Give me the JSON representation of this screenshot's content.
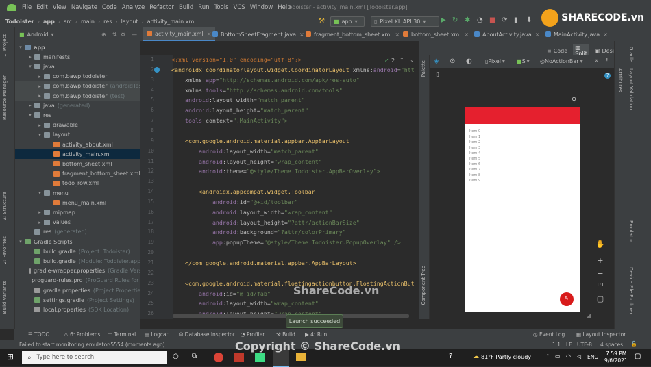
{
  "menu": {
    "items": [
      "File",
      "Edit",
      "View",
      "Navigate",
      "Code",
      "Analyze",
      "Refactor",
      "Build",
      "Run",
      "Tools",
      "VCS",
      "Window",
      "Help"
    ],
    "window_title": "Todoister - activity_main.xml [Todoister.app]"
  },
  "nav": {
    "crumbs": [
      "Todoister",
      "app",
      "src",
      "main",
      "res",
      "layout",
      "activity_main.xml"
    ],
    "run_config": "app",
    "device": "Pixel XL API 30"
  },
  "tabs": {
    "project_label": "Android",
    "files": [
      "activity_main.xml",
      "BottomSheetFragment.java",
      "fragment_bottom_sheet.xml",
      "bottom_sheet.xml",
      "AboutActivity.java",
      "MainActivity.java"
    ]
  },
  "view_modes": [
    "Code",
    "Split",
    "Design"
  ],
  "left_stripe": [
    "1: Project",
    "Resource Manager",
    "Z: Structure",
    "2: Favorites",
    "Build Variants"
  ],
  "right_stripe": [
    "Gradle",
    "Attributes",
    "Layout Validation",
    "Emulator",
    "Device File Explorer"
  ],
  "project_tree": [
    {
      "label": "app",
      "indent": 0,
      "arrow": "▾",
      "icon": "foldb",
      "bold": true
    },
    {
      "label": "manifests",
      "indent": 1,
      "arrow": "▸",
      "icon": "fold"
    },
    {
      "label": "java",
      "indent": 1,
      "arrow": "▾",
      "icon": "fold"
    },
    {
      "label": "com.bawp.todoister",
      "indent": 2,
      "arrow": "▸",
      "icon": "fold"
    },
    {
      "label": "com.bawp.todoister",
      "suffix": "(androidTest)",
      "indent": 2,
      "arrow": "▸",
      "icon": "fold",
      "hl": true
    },
    {
      "label": "com.bawp.todoister",
      "suffix": "(test)",
      "indent": 2,
      "arrow": "▸",
      "icon": "fold",
      "hl": true
    },
    {
      "label": "java",
      "suffix": "(generated)",
      "indent": 1,
      "arrow": "▸",
      "icon": "fold"
    },
    {
      "label": "res",
      "indent": 1,
      "arrow": "▾",
      "icon": "fold"
    },
    {
      "label": "drawable",
      "indent": 2,
      "arrow": "▸",
      "icon": "fold"
    },
    {
      "label": "layout",
      "indent": 2,
      "arrow": "▾",
      "icon": "fold"
    },
    {
      "label": "activity_about.xml",
      "indent": 3,
      "arrow": "",
      "icon": "xml"
    },
    {
      "label": "activity_main.xml",
      "indent": 3,
      "arrow": "",
      "icon": "xml",
      "sel": true
    },
    {
      "label": "bottom_sheet.xml",
      "indent": 3,
      "arrow": "",
      "icon": "xml"
    },
    {
      "label": "fragment_bottom_sheet.xml",
      "indent": 3,
      "arrow": "",
      "icon": "xml"
    },
    {
      "label": "todo_row.xml",
      "indent": 3,
      "arrow": "",
      "icon": "xml"
    },
    {
      "label": "menu",
      "indent": 2,
      "arrow": "▾",
      "icon": "fold"
    },
    {
      "label": "menu_main.xml",
      "indent": 3,
      "arrow": "",
      "icon": "xml"
    },
    {
      "label": "mipmap",
      "indent": 2,
      "arrow": "▸",
      "icon": "fold"
    },
    {
      "label": "values",
      "indent": 2,
      "arrow": "▸",
      "icon": "fold"
    },
    {
      "label": "res",
      "suffix": "(generated)",
      "indent": 1,
      "arrow": "",
      "icon": "fold"
    },
    {
      "label": "Gradle Scripts",
      "indent": 0,
      "arrow": "▾",
      "icon": "grad"
    },
    {
      "label": "build.gradle",
      "suffix": "(Project: Todoister)",
      "indent": 1,
      "arrow": "",
      "icon": "grad"
    },
    {
      "label": "build.gradle",
      "suffix": "(Module: Todoister.app)",
      "indent": 1,
      "arrow": "",
      "icon": "grad"
    },
    {
      "label": "gradle-wrapper.properties",
      "suffix": "(Gradle Version)",
      "indent": 1,
      "arrow": "",
      "icon": "prop"
    },
    {
      "label": "proguard-rules.pro",
      "suffix": "(ProGuard Rules for Todoister.app)",
      "indent": 1,
      "arrow": "",
      "icon": "prop"
    },
    {
      "label": "gradle.properties",
      "suffix": "(Project Properties)",
      "indent": 1,
      "arrow": "",
      "icon": "prop"
    },
    {
      "label": "settings.gradle",
      "suffix": "(Project Settings)",
      "indent": 1,
      "arrow": "",
      "icon": "grad"
    },
    {
      "label": "local.properties",
      "suffix": "(SDK Location)",
      "indent": 1,
      "arrow": "",
      "icon": "prop"
    }
  ],
  "code": {
    "line_numbers": [
      "1",
      "2",
      "3",
      "4",
      "5",
      "6",
      "7",
      "8",
      "9",
      "10",
      "11",
      "12",
      "13",
      "14",
      "15",
      "16",
      "17",
      "18",
      "19",
      "20",
      "21",
      "22",
      "23",
      "24",
      "25",
      "26"
    ],
    "lines": [
      [
        {
          "c": "decl",
          "t": "<?xml version=\"1.0\" encoding=\"utf-8\"?>"
        }
      ],
      [
        {
          "c": "tag",
          "t": "<androidx.coordinatorlayout.widget.CoordinatorLayout "
        },
        {
          "c": "attr",
          "t": "xmlns:"
        },
        {
          "c": "ns",
          "t": "android"
        },
        {
          "c": "attr",
          "t": "="
        },
        {
          "c": "val",
          "t": "\"http://schemas.android.com/apk/res/android\""
        }
      ],
      [
        {
          "c": "attr",
          "t": "    xmlns:"
        },
        {
          "c": "ns",
          "t": "app"
        },
        {
          "c": "attr",
          "t": "="
        },
        {
          "c": "val",
          "t": "\"http://schemas.android.com/apk/res-auto\""
        }
      ],
      [
        {
          "c": "attr",
          "t": "    xmlns:"
        },
        {
          "c": "ns",
          "t": "tools"
        },
        {
          "c": "attr",
          "t": "="
        },
        {
          "c": "val",
          "t": "\"http://schemas.android.com/tools\""
        }
      ],
      [
        {
          "c": "ns",
          "t": "    android"
        },
        {
          "c": "attr",
          "t": ":layout_width="
        },
        {
          "c": "val",
          "t": "\"match_parent\""
        }
      ],
      [
        {
          "c": "ns",
          "t": "    android"
        },
        {
          "c": "attr",
          "t": ":layout_height="
        },
        {
          "c": "val",
          "t": "\"match_parent\""
        }
      ],
      [
        {
          "c": "ns",
          "t": "    tools"
        },
        {
          "c": "attr",
          "t": ":context="
        },
        {
          "c": "val",
          "t": "\".MainActivity\">"
        }
      ],
      [
        {
          "c": "attr",
          "t": ""
        }
      ],
      [
        {
          "c": "tag",
          "t": "    <com.google.android.material.appbar.AppBarLayout"
        }
      ],
      [
        {
          "c": "ns",
          "t": "        android"
        },
        {
          "c": "attr",
          "t": ":layout_width="
        },
        {
          "c": "val",
          "t": "\"match_parent\""
        }
      ],
      [
        {
          "c": "ns",
          "t": "        android"
        },
        {
          "c": "attr",
          "t": ":layout_height="
        },
        {
          "c": "val",
          "t": "\"wrap_content\""
        }
      ],
      [
        {
          "c": "ns",
          "t": "        android"
        },
        {
          "c": "attr",
          "t": ":theme="
        },
        {
          "c": "val",
          "t": "\"@style/Theme.Todoister.AppBarOverlay\">"
        }
      ],
      [
        {
          "c": "attr",
          "t": ""
        }
      ],
      [
        {
          "c": "tag",
          "t": "        <androidx.appcompat.widget.Toolbar"
        }
      ],
      [
        {
          "c": "ns",
          "t": "            android"
        },
        {
          "c": "attr",
          "t": ":id="
        },
        {
          "c": "val",
          "t": "\"@+id/toolbar\""
        }
      ],
      [
        {
          "c": "ns",
          "t": "            android"
        },
        {
          "c": "attr",
          "t": ":layout_width="
        },
        {
          "c": "val",
          "t": "\"wrap_content\""
        }
      ],
      [
        {
          "c": "ns",
          "t": "            android"
        },
        {
          "c": "attr",
          "t": ":layout_height="
        },
        {
          "c": "val",
          "t": "\"?attr/actionBarSize\""
        }
      ],
      [
        {
          "c": "ns",
          "t": "            android"
        },
        {
          "c": "attr",
          "t": ":background="
        },
        {
          "c": "val",
          "t": "\"?attr/colorPrimary\""
        }
      ],
      [
        {
          "c": "ns",
          "t": "            app"
        },
        {
          "c": "attr",
          "t": ":popupTheme="
        },
        {
          "c": "val",
          "t": "\"@style/Theme.Todoister.PopupOverlay\" />"
        }
      ],
      [
        {
          "c": "attr",
          "t": ""
        }
      ],
      [
        {
          "c": "tag",
          "t": "    </com.google.android.material.appbar.AppBarLayout>"
        }
      ],
      [
        {
          "c": "attr",
          "t": ""
        }
      ],
      [
        {
          "c": "tag",
          "t": "    <com.google.android.material.floatingactionbutton.FloatingActionButton"
        }
      ],
      [
        {
          "c": "ns",
          "t": "        android"
        },
        {
          "c": "attr",
          "t": ":id="
        },
        {
          "c": "val",
          "t": "\"@+id/fab\""
        }
      ],
      [
        {
          "c": "ns",
          "t": "        android"
        },
        {
          "c": "attr",
          "t": ":layout_width="
        },
        {
          "c": "val",
          "t": "\"wrap_content\""
        }
      ],
      [
        {
          "c": "ns",
          "t": "        android"
        },
        {
          "c": "attr",
          "t": ":layout_height="
        },
        {
          "c": "val",
          "t": "\"wrap_content\""
        }
      ]
    ],
    "inspection_count": "2"
  },
  "design_toolbar": {
    "device": "Pixel",
    "api": "S",
    "theme": "NoActionBar",
    "palette": "Palette",
    "component_tree": "Component Tree"
  },
  "preview": {
    "items": [
      "Item 0",
      "Item 1",
      "Item 2",
      "Item 3",
      "Item 4",
      "Item 5",
      "Item 6",
      "Item 7",
      "Item 8",
      "Item 9"
    ],
    "zoom_ratio": "1:1",
    "appbar_color": "#e5202e",
    "fab_color": "#d81b1b"
  },
  "toast": "Launch succeeded",
  "tool_windows": {
    "left": [
      "TODO",
      "6: Problems",
      "Terminal",
      "Logcat",
      "Database Inspector",
      "Profiler",
      "Build",
      "4: Run"
    ],
    "right": [
      "Event Log",
      "Layout Inspector"
    ]
  },
  "status": {
    "message": "Failed to start monitoring emulator-5554 (moments ago)",
    "position": "1:1",
    "line_sep": "LF",
    "encoding": "UTF-8",
    "indent": "4 spaces"
  },
  "taskbar": {
    "search_placeholder": "Type here to search",
    "weather": "81°F  Partly cloudy",
    "lang": "ENG",
    "time": "7:59 PM",
    "date": "9/6/2021"
  },
  "watermark": {
    "logo_text": "SHARECODE.vn",
    "center_text": "ShareCode.vn",
    "copyright": "Copyright © ShareCode.vn"
  }
}
